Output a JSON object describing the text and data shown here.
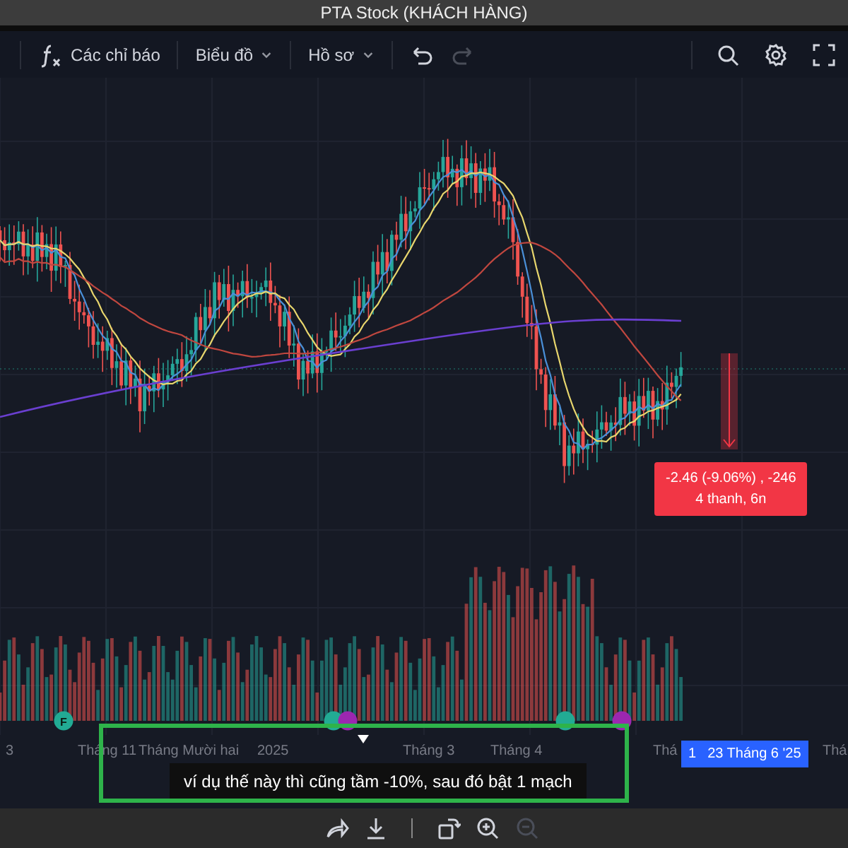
{
  "window": {
    "title": "PTA Stock (KHÁCH HÀNG)"
  },
  "toolbar": {
    "items": [
      {
        "kind": "indicator",
        "label": "Các chỉ báo"
      },
      {
        "kind": "menu",
        "label": "Biểu đồ"
      },
      {
        "kind": "menu",
        "label": "Hồ sơ"
      }
    ],
    "undo": {
      "disabled": false
    },
    "redo": {
      "disabled": true
    }
  },
  "measure": {
    "change": "-2.46 (-9.06%) , -246",
    "span": "4 thanh, 6n"
  },
  "markers": [
    {
      "label": "F",
      "color": "#22ab94"
    },
    {
      "color": "#22ab94"
    },
    {
      "color": "#9c27b0"
    },
    {
      "color": "#22ab94"
    },
    {
      "color": "#9c27b0"
    }
  ],
  "time_axis": {
    "labels": [
      "3",
      "Tháng 11",
      "Tháng Mười hai",
      "2025",
      "Tháng 3",
      "Tháng 4",
      "Thá",
      "Thá"
    ],
    "crosshair": [
      "1",
      "23 Tháng 6 '25"
    ]
  },
  "comment": {
    "text": "ví dụ thế này thì cũng tầm -10%, sau đó bật 1 mạch"
  },
  "bottom_toolbar": [
    {
      "kind": "share",
      "disabled": false
    },
    {
      "kind": "download",
      "disabled": false
    },
    {
      "kind": "rotate",
      "disabled": false
    },
    {
      "kind": "zoom-in",
      "disabled": false
    },
    {
      "kind": "zoom-out",
      "disabled": true
    }
  ]
}
